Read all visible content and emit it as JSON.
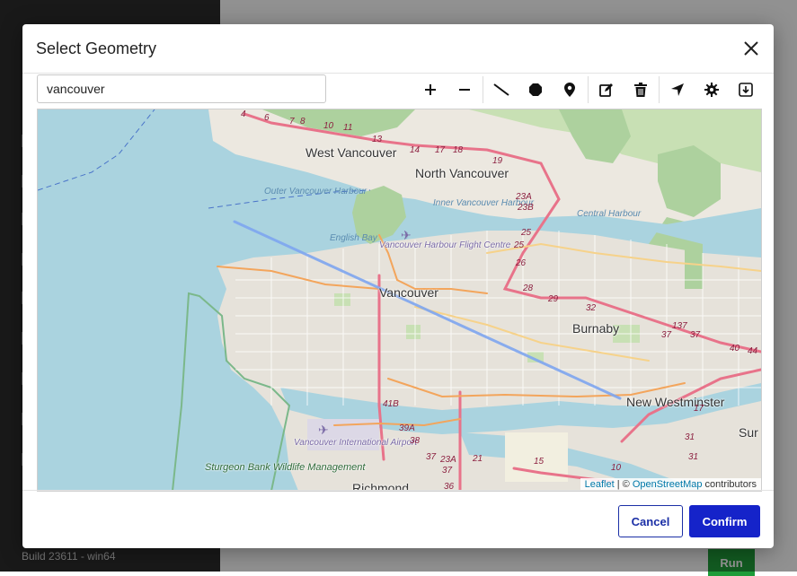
{
  "background": {
    "build_label": "Build 23611 - win64",
    "run_label": "Run"
  },
  "dialog": {
    "title": "Select Geometry",
    "close_icon": "close-icon",
    "search": {
      "value": "vancouver",
      "placeholder": ""
    },
    "toolbar": [
      {
        "name": "zoom-in-button",
        "icon": "plus-icon"
      },
      {
        "name": "zoom-out-button",
        "icon": "minus-icon"
      },
      {
        "name": "draw-line-button",
        "icon": "line-icon"
      },
      {
        "name": "draw-polygon-button",
        "icon": "polygon-icon"
      },
      {
        "name": "draw-marker-button",
        "icon": "marker-icon"
      },
      {
        "name": "edit-button",
        "icon": "edit-icon"
      },
      {
        "name": "delete-button",
        "icon": "trash-icon"
      },
      {
        "name": "locate-button",
        "icon": "navigation-arrow-icon"
      },
      {
        "name": "settings-button",
        "icon": "gear-icon"
      },
      {
        "name": "download-button",
        "icon": "download-icon"
      }
    ],
    "map": {
      "labels": {
        "west_vancouver": "West Vancouver",
        "north_vancouver": "North Vancouver",
        "vancouver": "Vancouver",
        "burnaby": "Burnaby",
        "new_westminster": "New Westminster",
        "richmond": "Richmond",
        "surrey": "Sur",
        "outer_harbour": "Outer Vancouver Harbour",
        "inner_harbour": "Inner Vancouver Harbour",
        "central_harbour": "Central Harbour",
        "english_bay": "English Bay",
        "harbour_flight_centre": "Vancouver Harbour Flight Centre",
        "airport": "Vancouver International Airport",
        "sturgeon_bank": "Sturgeon Bank Wildlife Management"
      },
      "shields": [
        "4",
        "6",
        "7",
        "8",
        "10",
        "11",
        "13",
        "14",
        "17",
        "18",
        "19",
        "23A",
        "23B",
        "25",
        "25",
        "26",
        "28",
        "29",
        "32",
        "37",
        "137",
        "37",
        "40",
        "44",
        "41B",
        "39A",
        "38",
        "37",
        "23A",
        "21",
        "15",
        "37",
        "36",
        "10",
        "31",
        "31",
        "17"
      ],
      "attribution": {
        "leaflet": "Leaflet",
        "separator": " | © ",
        "osm": "OpenStreetMap",
        "suffix": " contributors"
      },
      "drawn_line_color": "#7ea6f0"
    },
    "buttons": {
      "cancel": "Cancel",
      "confirm": "Confirm"
    }
  },
  "colors": {
    "accent": "#1523c9",
    "water": "#aad3df",
    "run": "#1f9d3a"
  }
}
